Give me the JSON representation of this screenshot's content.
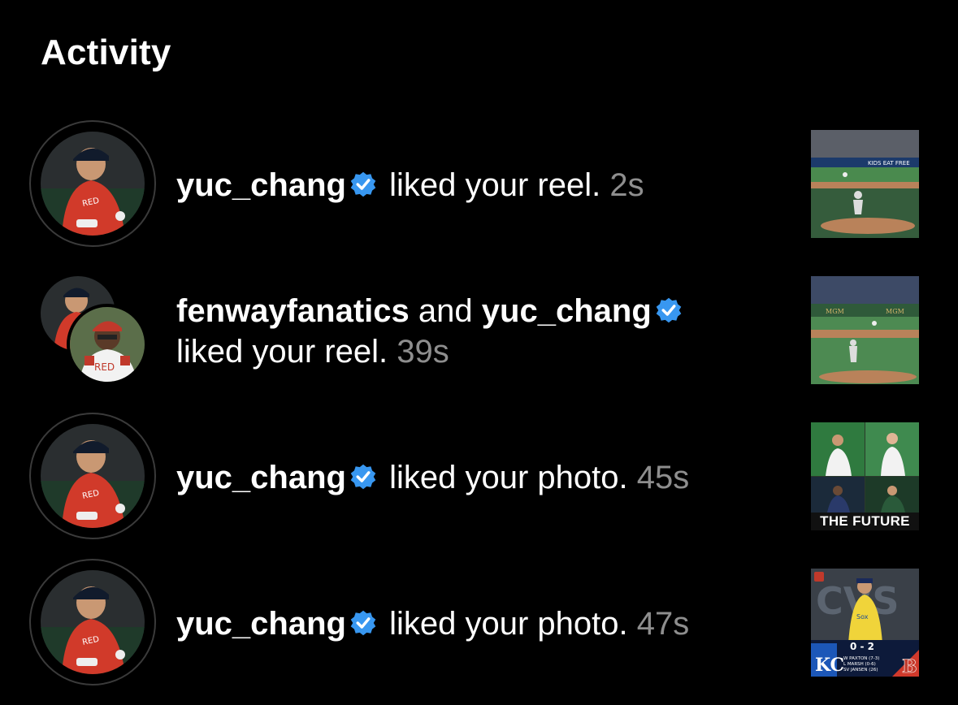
{
  "header": {
    "title": "Activity"
  },
  "activity": [
    {
      "users": [
        "yuc_chang"
      ],
      "action": "liked your reel.",
      "time": "2s",
      "thumb": "baseball-pitch-reel"
    },
    {
      "users": [
        "fenwayfanatics",
        "yuc_chang"
      ],
      "connector": "and",
      "action": "liked your reel.",
      "time": "39s",
      "thumb": "baseball-field-reel"
    },
    {
      "users": [
        "yuc_chang"
      ],
      "action": "liked your photo.",
      "time": "45s",
      "thumb": "the-future-collage",
      "thumb_text": "THE FUTURE"
    },
    {
      "users": [
        "yuc_chang"
      ],
      "action": "liked your photo.",
      "time": "47s",
      "thumb": "scoreboard-photo",
      "scoreboard": {
        "score": "0 - 2",
        "lines": [
          "W PAXTON (7-3)",
          "L MARSH (0-6)",
          "SV JANSEN (26)"
        ]
      }
    }
  ],
  "colors": {
    "background": "#000000",
    "text": "#ffffff",
    "timestamp": "#8e8e8e",
    "verified": "#3897f0"
  }
}
